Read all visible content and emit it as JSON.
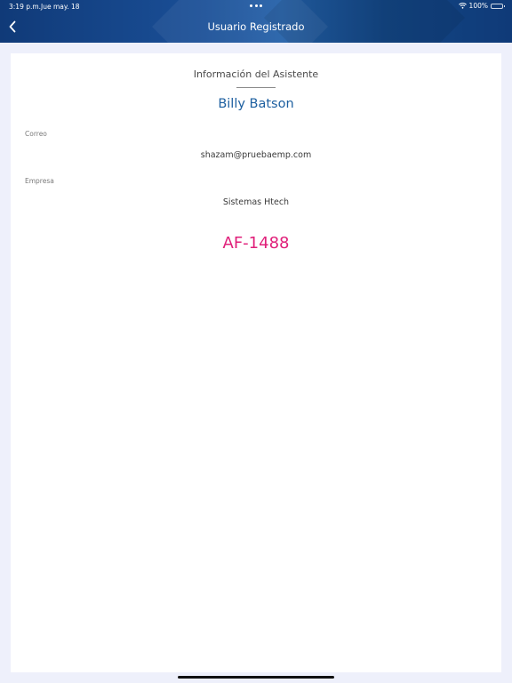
{
  "status_bar": {
    "time": "3:19 p.m.",
    "date": "Jue may. 18",
    "battery": "100%",
    "icons": [
      "wifi-icon",
      "battery-icon",
      "more-dots-icon"
    ]
  },
  "header": {
    "title": "Usuario Registrado",
    "back_icon": "chevron-left-icon"
  },
  "card": {
    "section_title": "Información del Asistente",
    "attendee_name": "Billy Batson",
    "fields": [
      {
        "label": "Correo",
        "value": "shazam@pruebaemp.com"
      },
      {
        "label": "Empresa",
        "value": "Sistemas Htech"
      }
    ],
    "code": "AF-1488"
  },
  "colors": {
    "header_bg": "#1a4f97",
    "name": "#1d5fa0",
    "code": "#e0207a",
    "page_bg": "#eef0fb"
  }
}
